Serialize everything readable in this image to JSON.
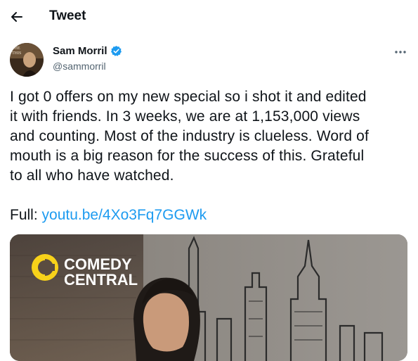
{
  "header": {
    "title": "Tweet",
    "back_icon": "arrow-left-icon"
  },
  "tweet": {
    "author": {
      "display_name": "Sam Morril",
      "handle": "@sammorril",
      "verified": true,
      "verified_color": "#1d9bf0"
    },
    "text_lines": [
      "I got 0 offers on my new special so i shot it and edited",
      "it with friends. In 3 weeks, we are at 1,153,000 views",
      "and counting. Most of the industry is clueless. Word of",
      "mouth is a big reason for the success of this. Grateful",
      "to all who have watched."
    ],
    "full_label": "Full:",
    "link_text": "youtu.be/4Xo3Fq7GGWk",
    "media": {
      "logo_text_line1": "COMEDY",
      "logo_text_line2": "CENTRAL"
    }
  },
  "colors": {
    "text": "#0f1419",
    "secondary": "#536471",
    "link": "#1d9bf0"
  }
}
